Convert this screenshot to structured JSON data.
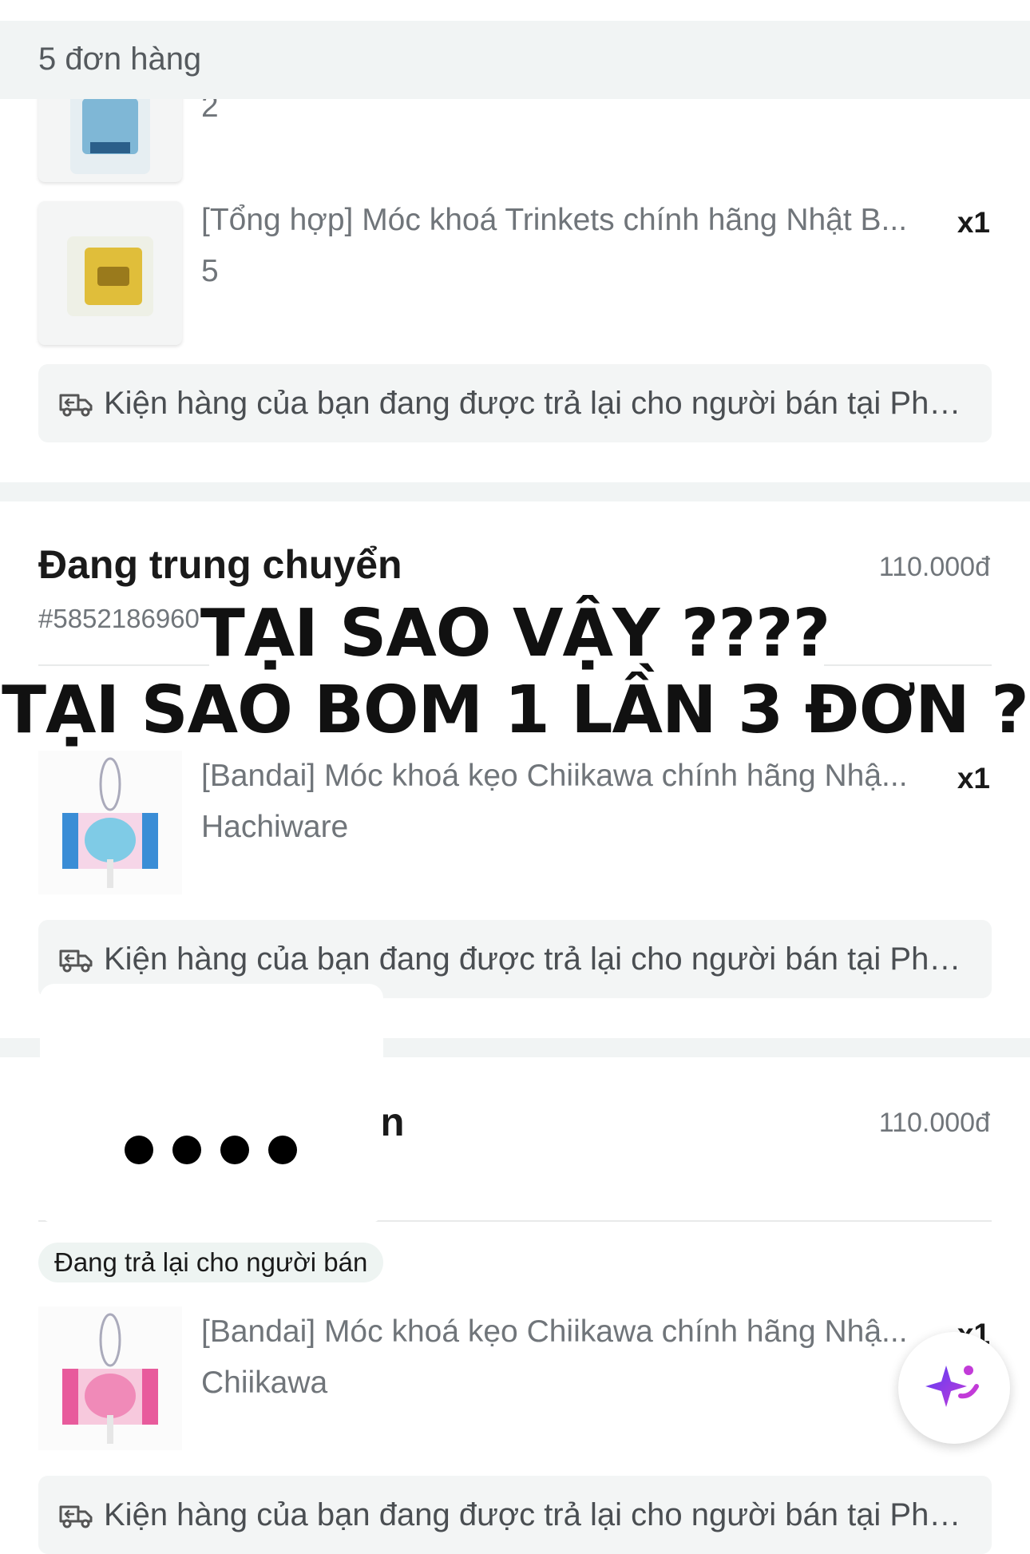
{
  "header": {
    "order_count_label": "5 đơn hàng"
  },
  "order1": {
    "items": [
      {
        "variant": "2"
      },
      {
        "title": "[Tổng hợp] Móc khoá Trinkets chính hãng Nhật B...",
        "variant": "5",
        "qty": "x1"
      }
    ],
    "return_note": "Kiện hàng của bạn đang được trả lại cho người bán tại Phư..."
  },
  "order2": {
    "status": "Đang trung chuyển",
    "price": "110.000đ",
    "order_id": "#5852186960",
    "items": [
      {
        "title": "[Bandai] Móc khoá kẹo Chiikawa chính hãng Nhậ...",
        "variant": "Hachiware",
        "qty": "x1"
      }
    ],
    "return_note": "Kiện hàng của bạn đang được trả lại cho người bán tại Phư..."
  },
  "order3": {
    "status_partial": "n",
    "price": "110.000đ",
    "badge": "Đang trả lại cho người bán",
    "items": [
      {
        "title": "[Bandai] Móc khoá kẹo Chiikawa chính hãng Nhậ...",
        "variant": "Chiikawa",
        "qty": "x1"
      }
    ],
    "return_note": "Kiện hàng của bạn đang được trả lại cho người bán tại Phư..."
  },
  "overlay": {
    "line1": "TẠI SAO VẬY ????",
    "line2": "TẠI SAO BOM 1 LẦN 3 ĐƠN ?"
  },
  "icons": {
    "return_note": "truck-return-icon",
    "assistant": "sparkle-ai-icon"
  },
  "colors": {
    "assistant_gradient": [
      "#5b3df5",
      "#c23bd8"
    ],
    "note_background": "#f3f5f5",
    "badge_background": "#eef4f2"
  }
}
